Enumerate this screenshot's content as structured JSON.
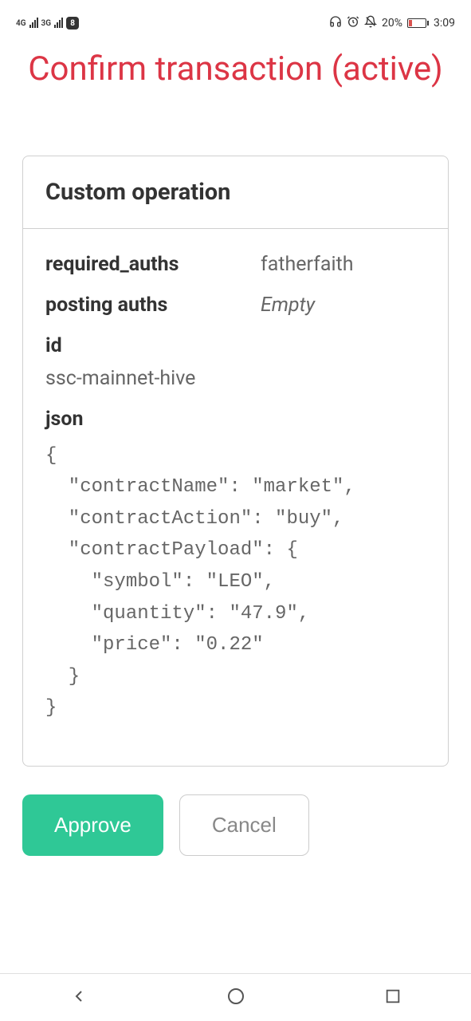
{
  "status_bar": {
    "network1": "4G",
    "network2": "3G",
    "vpn_badge": "8",
    "battery_percent": "20%",
    "time": "3:09"
  },
  "title": "Confirm transaction (active)",
  "card": {
    "header": "Custom operation",
    "fields": {
      "required_auths_label": "required_auths",
      "required_auths_value": "fatherfaith",
      "posting_auths_label": "posting auths",
      "posting_auths_value": "Empty",
      "id_label": "id",
      "id_value": "ssc-mainnet-hive",
      "json_label": "json",
      "json_value": "{\n  \"contractName\": \"market\",\n  \"contractAction\": \"buy\",\n  \"contractPayload\": {\n    \"symbol\": \"LEO\",\n    \"quantity\": \"47.9\",\n    \"price\": \"0.22\"\n  }\n}"
    }
  },
  "buttons": {
    "approve": "Approve",
    "cancel": "Cancel"
  }
}
